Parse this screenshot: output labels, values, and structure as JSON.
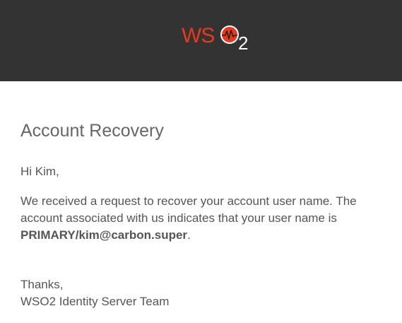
{
  "header": {
    "logo_text": "WSO2",
    "logo_color": "#e8391d",
    "background_color": "#333333"
  },
  "email": {
    "title": "Account Recovery",
    "greeting": "Hi Kim,",
    "body_before": "We received a request to recover your account user name. The account associated with us indicates that your user name is ",
    "username": "PRIMARY/kim@carbon.super",
    "body_after": ".",
    "signoff": "Thanks,",
    "team": "WSO2 Identity Server Team"
  }
}
